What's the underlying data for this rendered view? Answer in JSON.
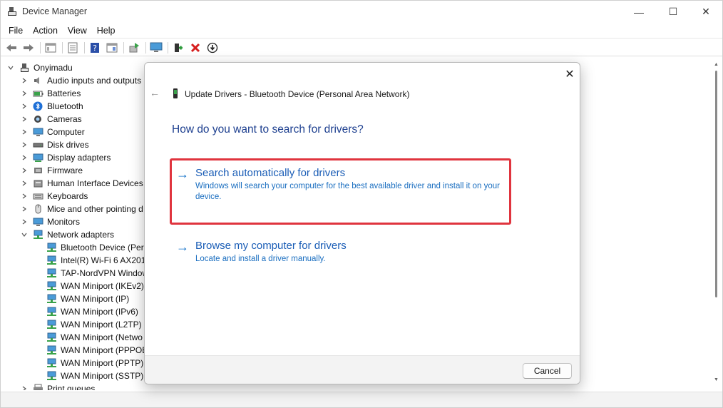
{
  "window": {
    "title": "Device Manager",
    "min_glyph": "—",
    "max_glyph": "☐",
    "close_glyph": "✕"
  },
  "menu": {
    "items": [
      "File",
      "Action",
      "View",
      "Help"
    ]
  },
  "tree": {
    "root": "Onyimadu",
    "categories": [
      {
        "label": "Audio inputs and outputs",
        "icon": "speaker-icon"
      },
      {
        "label": "Batteries",
        "icon": "battery-icon"
      },
      {
        "label": "Bluetooth",
        "icon": "bluetooth-icon"
      },
      {
        "label": "Cameras",
        "icon": "camera-icon"
      },
      {
        "label": "Computer",
        "icon": "computer-icon"
      },
      {
        "label": "Disk drives",
        "icon": "disk-icon"
      },
      {
        "label": "Display adapters",
        "icon": "display-icon"
      },
      {
        "label": "Firmware",
        "icon": "firmware-icon"
      },
      {
        "label": "Human Interface Devices",
        "icon": "hid-icon"
      },
      {
        "label": "Keyboards",
        "icon": "keyboard-icon"
      },
      {
        "label": "Mice and other pointing d",
        "icon": "mouse-icon"
      },
      {
        "label": "Monitors",
        "icon": "monitor-icon"
      },
      {
        "label": "Network adapters",
        "icon": "network-icon"
      }
    ],
    "network_children": [
      "Bluetooth Device (Pers",
      "Intel(R) Wi-Fi 6 AX201",
      "TAP-NordVPN Window",
      "WAN Miniport (IKEv2)",
      "WAN Miniport (IP)",
      "WAN Miniport (IPv6)",
      "WAN Miniport (L2TP)",
      "WAN Miniport (Netwo",
      "WAN Miniport (PPPOE",
      "WAN Miniport (PPTP)",
      "WAN Miniport (SSTP)"
    ],
    "last_category": "Print queues"
  },
  "dialog": {
    "title": "Update Drivers - Bluetooth Device (Personal Area Network)",
    "heading": "How do you want to search for drivers?",
    "option_auto_title": "Search automatically for drivers",
    "option_auto_desc": "Windows will search your computer for the best available driver and install it on your device.",
    "option_browse_title": "Browse my computer for drivers",
    "option_browse_desc": "Locate and install a driver manually.",
    "cancel_label": "Cancel",
    "close_glyph": "✕",
    "back_glyph": "←",
    "arrow_glyph": "→"
  },
  "colors": {
    "link_blue": "#1a5db6",
    "heading_blue": "#1d3f8f",
    "highlight_red": "#e0343e"
  }
}
